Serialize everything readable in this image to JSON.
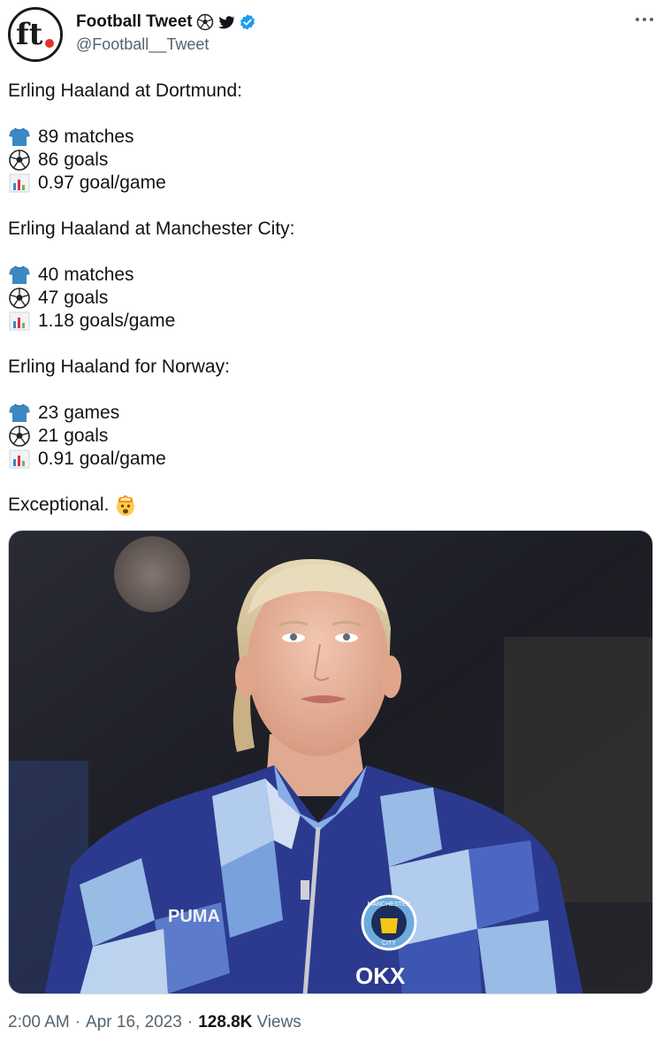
{
  "account": {
    "display_name": "Football Tweet",
    "handle": "@Football__Tweet",
    "avatar_text": "ft",
    "verified": true,
    "name_icons": [
      "soccer-ball-icon",
      "twitter-bird-icon",
      "verified-badge-icon"
    ]
  },
  "tweet": {
    "lines": [
      {
        "kind": "text",
        "text": "Erling Haaland at Dortmund:"
      },
      {
        "kind": "blank"
      },
      {
        "kind": "stat",
        "icon": "shirt-icon",
        "text": "89 matches"
      },
      {
        "kind": "stat",
        "icon": "soccer-ball-icon",
        "text": "86 goals"
      },
      {
        "kind": "stat",
        "icon": "bar-chart-icon",
        "text": "0.97 goal/game"
      },
      {
        "kind": "blank"
      },
      {
        "kind": "text",
        "text": "Erling Haaland at Manchester City:"
      },
      {
        "kind": "blank"
      },
      {
        "kind": "stat",
        "icon": "shirt-icon",
        "text": "40 matches"
      },
      {
        "kind": "stat",
        "icon": "soccer-ball-icon",
        "text": "47 goals"
      },
      {
        "kind": "stat",
        "icon": "bar-chart-icon",
        "text": "1.18 goals/game"
      },
      {
        "kind": "blank"
      },
      {
        "kind": "text",
        "text": "Erling Haaland for Norway:"
      },
      {
        "kind": "blank"
      },
      {
        "kind": "stat",
        "icon": "shirt-icon",
        "text": "23 games"
      },
      {
        "kind": "stat",
        "icon": "soccer-ball-icon",
        "text": "21 goals"
      },
      {
        "kind": "stat",
        "icon": "bar-chart-icon",
        "text": "0.91 goal/game"
      },
      {
        "kind": "blank"
      },
      {
        "kind": "closing",
        "text": "Exceptional.",
        "icon": "exploding-head-icon"
      }
    ]
  },
  "media": {
    "brand_left": "PUMA",
    "crest_text_top": "MANCHESTER",
    "crest_text_bottom": "CITY",
    "sponsor": "OKX"
  },
  "meta": {
    "time": "2:00 AM",
    "date": "Apr 16, 2023",
    "views_count": "128.8K",
    "views_label": "Views",
    "separator": "·"
  },
  "colors": {
    "text": "#0f1419",
    "muted": "#536471",
    "verified": "#1d9bf0",
    "shirt": "#3b88c3"
  }
}
